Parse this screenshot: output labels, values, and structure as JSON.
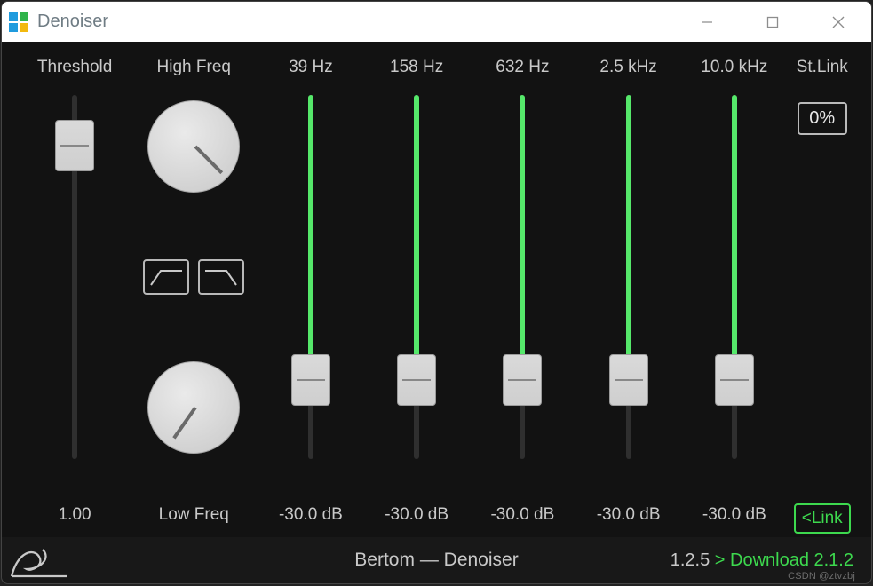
{
  "window": {
    "title": "Denoiser",
    "icon_colors": [
      "#1f9bde",
      "#2fb34a",
      "#1f9bde",
      "#f2b90f"
    ]
  },
  "threshold": {
    "label": "Threshold",
    "value": "1.00",
    "pos": 0.92
  },
  "freq": {
    "high_label": "High Freq",
    "low_label": "Low Freq",
    "high_angle_deg": 135,
    "low_angle_deg": 215
  },
  "bands": [
    {
      "label": "39 Hz",
      "value": "-30.0 dB",
      "pos": 0.17
    },
    {
      "label": "158 Hz",
      "value": "-30.0 dB",
      "pos": 0.17
    },
    {
      "label": "632 Hz",
      "value": "-30.0 dB",
      "pos": 0.17
    },
    {
      "label": "2.5 kHz",
      "value": "-30.0 dB",
      "pos": 0.17
    },
    {
      "label": "10.0 kHz",
      "value": "-30.0 dB",
      "pos": 0.17
    }
  ],
  "stlink": {
    "label": "St.Link",
    "percent": "0%",
    "link_label": "<Link"
  },
  "footer": {
    "brand": "Bertom — Denoiser",
    "version": "1.2.5",
    "download": "> Download 2.1.2"
  },
  "watermark": "CSDN @ztvzbj"
}
